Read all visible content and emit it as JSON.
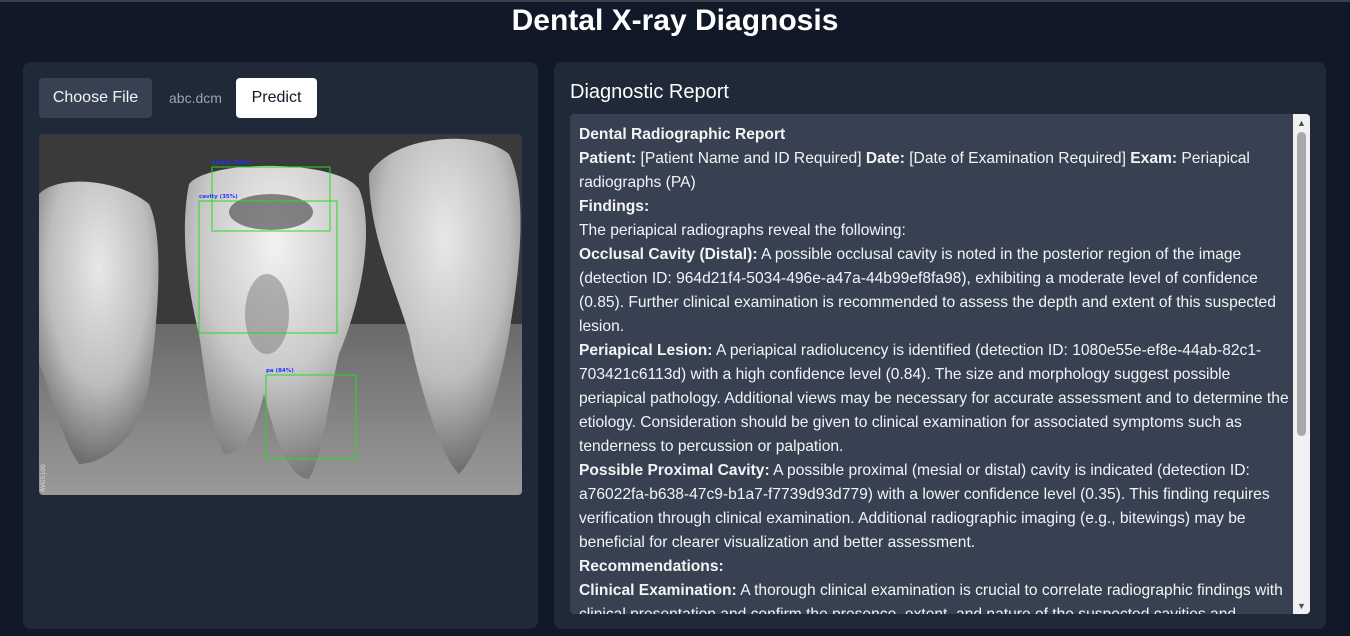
{
  "app": {
    "title": "Dental X-ray Diagnosis"
  },
  "upload": {
    "choose_label": "Choose File",
    "file_name": "abc.dcm",
    "predict_label": "Predict"
  },
  "xray": {
    "side_label": "RVG5100",
    "detections": [
      {
        "label": "cavity (84%)"
      },
      {
        "label": "cavity (35%)"
      },
      {
        "label": "pa (84%)"
      }
    ],
    "box_color": "#22dd22",
    "label_color": "#2233ff"
  },
  "report": {
    "heading": "Diagnostic Report",
    "title": "Dental Radiographic Report",
    "patient_label": "Patient:",
    "patient_value": " [Patient Name and ID Required] ",
    "date_label": "Date:",
    "date_value": " [Date of Examination Required] ",
    "exam_label": "Exam:",
    "exam_value": " Periapical radiographs (PA)",
    "findings_heading": "Findings:",
    "findings_intro": "The periapical radiographs reveal the following:",
    "finding1_label": "Occlusal Cavity (Distal):",
    "finding1_text": " A possible occlusal cavity is noted in the posterior region of the image (detection ID: 964d21f4-5034-496e-a47a-44b99ef8fa98), exhibiting a moderate level of confidence (0.85). Further clinical examination is recommended to assess the depth and extent of this suspected lesion.",
    "finding2_label": "Periapical Lesion:",
    "finding2_text": " A periapical radiolucency is identified (detection ID: 1080e55e-ef8e-44ab-82c1-703421c6113d) with a high confidence level (0.84). The size and morphology suggest possible periapical pathology. Additional views may be necessary for accurate assessment and to determine the etiology. Consideration should be given to clinical examination for associated symptoms such as tenderness to percussion or palpation.",
    "finding3_label": "Possible Proximal Cavity:",
    "finding3_text": " A possible proximal (mesial or distal) cavity is indicated (detection ID: a76022fa-b638-47c9-b1a7-f7739d93d779) with a lower confidence level (0.35). This finding requires verification through clinical examination. Additional radiographic imaging (e.g., bitewings) may be beneficial for clearer visualization and better assessment.",
    "recommendations_heading": "Recommendations:",
    "rec1_label": "Clinical Examination:",
    "rec1_text": " A thorough clinical examination is crucial to correlate radiographic findings with clinical presentation and confirm the presence, extent, and nature of the suspected cavities and lesions."
  },
  "colors": {
    "background": "#111827",
    "panel": "#1f2937",
    "report_box": "#374151",
    "primary_button": "#ffffff"
  }
}
